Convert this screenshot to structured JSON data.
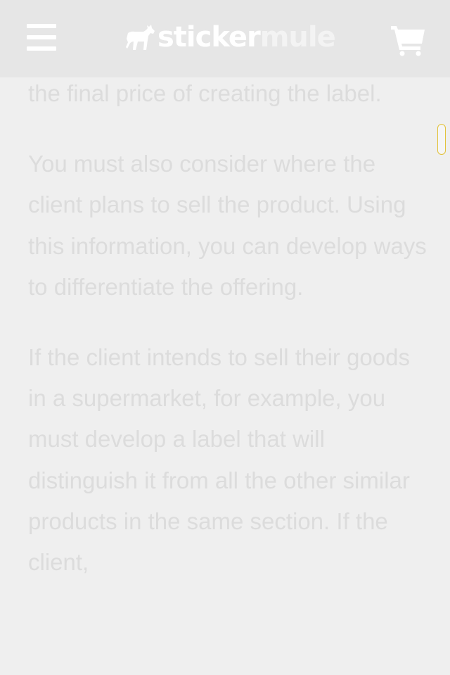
{
  "header": {
    "logo_primary": "sticker",
    "logo_secondary": "mule",
    "menu_icon": "hamburger-menu-icon",
    "cart_icon": "shopping-cart-icon"
  },
  "article": {
    "paragraphs": [
      "the final price of creating the label.",
      "You must also consider where the client plans to sell the product. Using this information, you can develop ways to differentiate the offering.",
      "If the client intends to sell their goods in a supermarket, for example, you must develop a label that will distinguish it from all the other similar products in the same section. If the client,"
    ]
  },
  "colors": {
    "header_bg": "#e6e6e6",
    "page_bg": "#efefef",
    "text": "#dcdcdc",
    "icon": "#ffffff",
    "scroll_highlight": "#e2c23a"
  }
}
